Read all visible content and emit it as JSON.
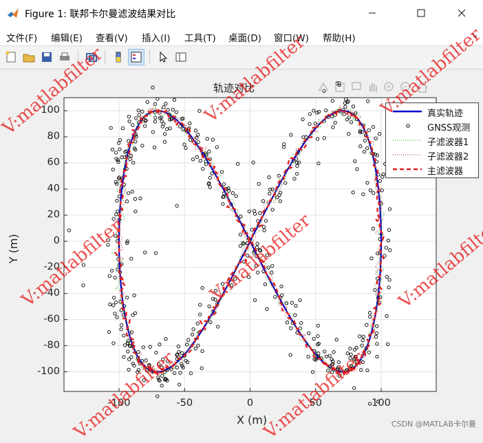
{
  "window": {
    "title": "Figure 1: 联邦卡尔曼滤波结果对比",
    "icon": "matlab-logo-icon"
  },
  "menu": [
    "文件(F)",
    "编辑(E)",
    "查看(V)",
    "插入(I)",
    "工具(T)",
    "桌面(D)",
    "窗口(W)",
    "帮助(H)"
  ],
  "toolbar_icons": [
    "new-figure-icon",
    "open-file-icon",
    "save-icon",
    "print-icon",
    "link-plot-icon",
    "insert-colorbar-icon",
    "insert-legend-icon",
    "select-pointer-icon",
    "property-inspector-icon"
  ],
  "axes_toolbar_icons": [
    "export-icon",
    "brush-icon",
    "datatip-icon",
    "pan-icon",
    "zoom-in-icon",
    "zoom-out-icon",
    "home-icon"
  ],
  "watermark": "V:matlabfilter",
  "credit": "CSDN @MATLAB卡尔曼",
  "chart_data": {
    "type": "line",
    "title": "轨迹对比",
    "xlabel": "X (m)",
    "ylabel": "Y (m)",
    "xlim": [
      -142,
      142
    ],
    "ylim": [
      -115,
      110
    ],
    "xticks": [
      -100,
      -50,
      0,
      50,
      100
    ],
    "yticks": [
      -100,
      -80,
      -60,
      -40,
      -20,
      0,
      20,
      40,
      60,
      80,
      100
    ],
    "grid": true,
    "legend_position": "top-right",
    "trajectory": {
      "shape": "figure-eight (lemniscate)",
      "x_amplitude": 100,
      "y_amplitude": 100
    },
    "series": [
      {
        "name": "真实轨迹",
        "style": "solid",
        "color": "#0000cc"
      },
      {
        "name": "GNSS观测",
        "style": "markers",
        "marker": "circle",
        "color": "#000000",
        "noise_std": 6
      },
      {
        "name": "子滤波器1",
        "style": "dotted",
        "color": "#22aa22"
      },
      {
        "name": "子滤波器2",
        "style": "dotted",
        "color": "#aa2222"
      },
      {
        "name": "主滤波器",
        "style": "dashed",
        "color": "#e02020"
      }
    ]
  },
  "colors": {
    "true_track": "#0000cc",
    "main_filter": "#e02020",
    "watermark": "#e61e1e"
  }
}
